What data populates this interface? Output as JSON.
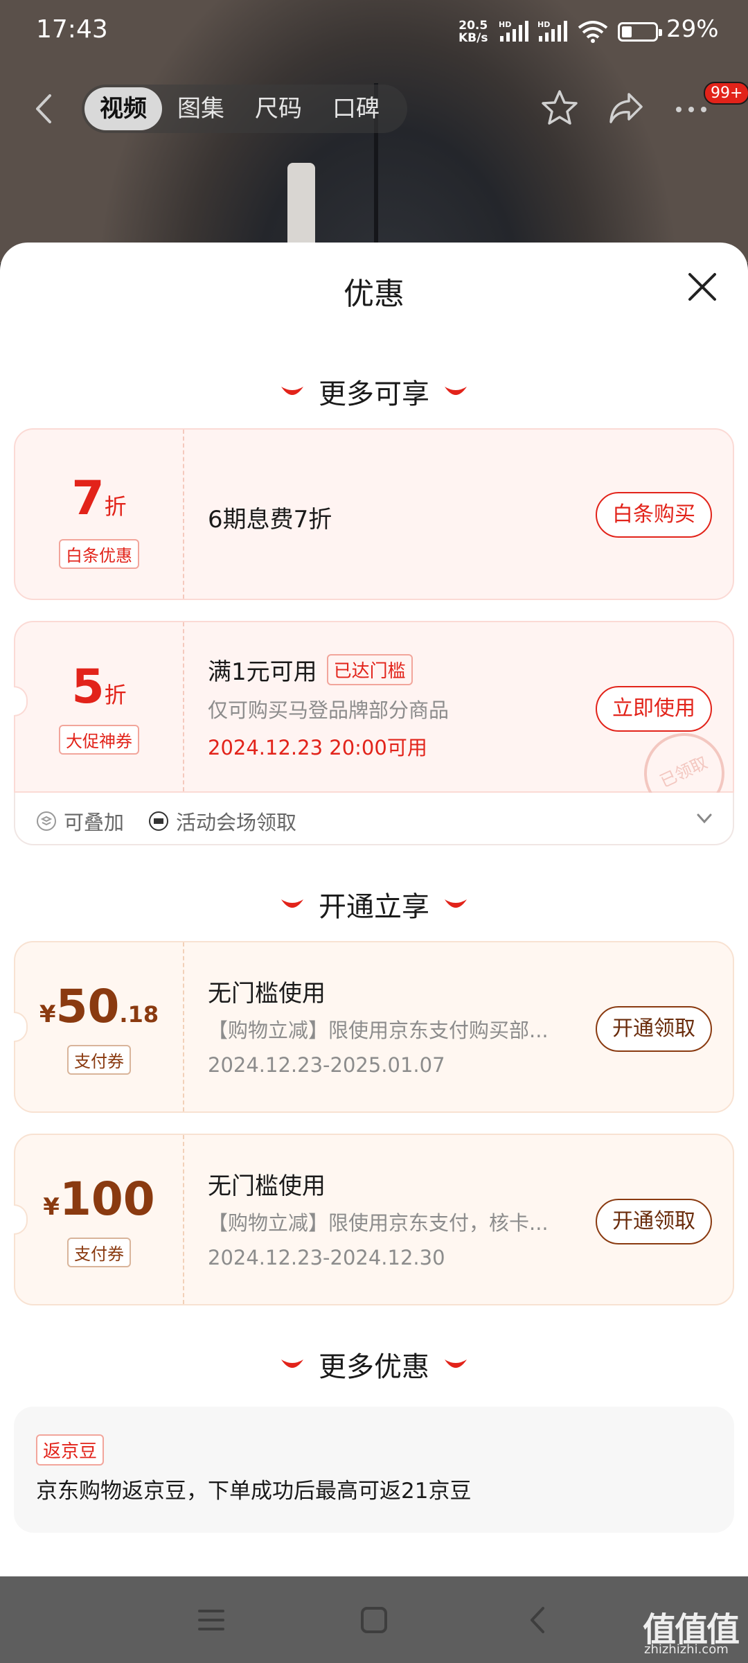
{
  "status_bar": {
    "time": "17:43",
    "net_speed_top": "20.5",
    "net_speed_unit": "KB/s",
    "hd1": "HD",
    "hd2": "HD",
    "battery_pct": "29%",
    "battery_level": 0.29
  },
  "top_nav": {
    "tabs": [
      {
        "label": "视频",
        "active": true
      },
      {
        "label": "图集",
        "active": false
      },
      {
        "label": "尺码",
        "active": false
      },
      {
        "label": "口碑",
        "active": false
      }
    ],
    "badge": "99+"
  },
  "sheet": {
    "title": "优惠",
    "sections": {
      "more_available": "更多可享",
      "open_enjoy": "开通立享",
      "more_offers": "更多优惠"
    }
  },
  "coupons": {
    "baitiao": {
      "value": "7",
      "unit": "折",
      "tag": "白条优惠",
      "desc": "6期息费7折",
      "button": "白条购买"
    },
    "promo": {
      "value": "5",
      "unit": "折",
      "tag": "大促神券",
      "title": "满1元可用",
      "threshold": "已达门槛",
      "desc": "仅可购买马登品牌部分商品",
      "time": "2024.12.23 20:00可用",
      "button": "立即使用",
      "stamp": "已领取",
      "footer_stackable": "可叠加",
      "footer_source": "活动会场领取"
    },
    "pay1": {
      "currency": "¥",
      "value_int": "50",
      "value_dec": ".18",
      "tag": "支付券",
      "title": "无门槛使用",
      "desc": "【购物立减】限使用京东支付购买部...",
      "dates": "2024.12.23-2025.01.07",
      "button": "开通领取"
    },
    "pay2": {
      "currency": "¥",
      "value_int": "100",
      "tag": "支付券",
      "title": "无门槛使用",
      "desc": "【购物立减】限使用京东支付，核卡...",
      "dates": "2024.12.23-2024.12.30",
      "button": "开通领取"
    }
  },
  "more_offer": {
    "tag": "返京豆",
    "text": "京东购物返京豆，下单成功后最高可返21京豆"
  },
  "watermark": {
    "logo": "值值值",
    "url": "zhizhizhi.com"
  },
  "colors": {
    "accent_red": "#e2231a",
    "brown": "#8a3a10",
    "sheet_bg": "#ffffff"
  }
}
